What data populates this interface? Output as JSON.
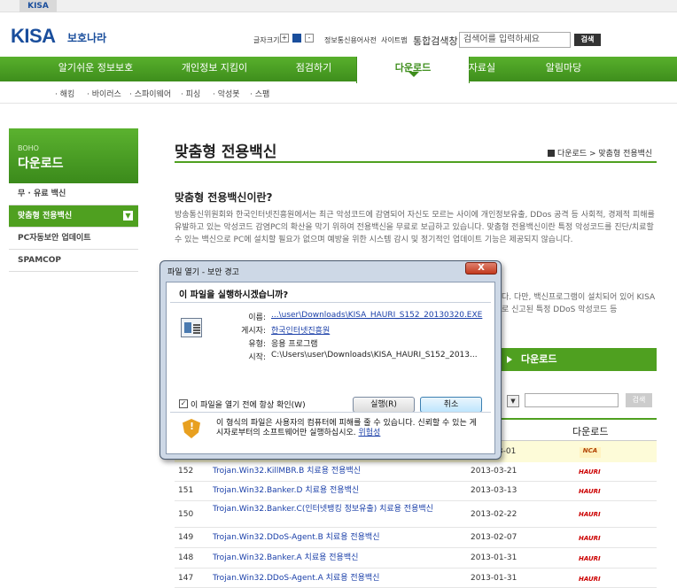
{
  "top": {
    "kisa_tab": "KISA"
  },
  "logo": {
    "main": "KISA",
    "sub": "보호나라"
  },
  "utility": {
    "font_size_label": "글자크기",
    "plus": "+",
    "reset": "■",
    "minus": "-",
    "links": [
      "정보통신용어사전",
      "사이트맵"
    ],
    "search_label": "통합검색창",
    "search_placeholder": "검색어를 입력하세요",
    "search_button": "검색"
  },
  "gnb": {
    "items": [
      "알기쉬운 정보보호",
      "개인정보 지킴이",
      "점검하기",
      "다운로드",
      "자료실",
      "알림마당"
    ]
  },
  "subnav": {
    "items": [
      "· 해킹",
      "· 바이러스",
      "· 스파이웨어",
      "· 피싱",
      "· 악성봇",
      "· 스팸"
    ]
  },
  "lnb": {
    "head_en": "BOHO",
    "head_ko": "다운로드",
    "items": [
      "무 · 유료 백신",
      "맞춤형 전용백신",
      "PC자동보안 업데이트",
      "SPAMCOP"
    ]
  },
  "content": {
    "page_title": "맞춤형 전용백신",
    "breadcrumb": "다운로드 > 맞춤형 전용백신",
    "section_title": "맞춤형 전용백신이란?",
    "paragraph": "방송통신위원회와 한국인터넷진흥원에서는 최근 악성코드에 감염되어 자신도 모르는 사이에 개인정보유출, DDos 공격 등 사회적, 경제적 피해를 유발하고 있는 악성코드 감염PC의 확산을 막기 위하여 전용백신을 무료로 보급하고 있습니다. 맞춤형 전용백신이란 특정 악성코드를 진단/치료할 수 있는 백신으로 PC에 설치할 필요가 없으며 예방을 위한 시스템 감시 및 정기적인 업데이트 기능은 제공되지 않습니다.",
    "paragraph2": "다. 다만, 백신프로그램이 설치되어 있어 KISA로 신고된 특정 DDoS 악성코드 등",
    "download_tab": "다운로드",
    "table_search_button": "검색",
    "table_header_download": "다운로드"
  },
  "table": {
    "highlight_date": "2013-03-01",
    "rows": [
      {
        "num": "152",
        "title": "Trojan.Win32.KillMBR.B 치료용 전용백신",
        "date": "2013-03-21",
        "vendor": "HAURI"
      },
      {
        "num": "151",
        "title": "Trojan.Win32.Banker.D 치료용 전용백신",
        "date": "2013-03-13",
        "vendor": "HAURI"
      },
      {
        "num": "150",
        "title": "Trojan.Win32.Banker.C(인터넷뱅킹 정보유출) 치료용 전용백신",
        "date": "2013-02-22",
        "vendor": "HAURI"
      },
      {
        "num": "149",
        "title": "Trojan.Win32.DDoS-Agent.B 치료용 전용백신",
        "date": "2013-02-07",
        "vendor": "HAURI"
      },
      {
        "num": "148",
        "title": "Trojan.Win32.Banker.A 치료용 전용백신",
        "date": "2013-01-31",
        "vendor": "HAURI"
      },
      {
        "num": "147",
        "title": "Trojan.Win32.DDoS-Agent.A 치료용 전용백신",
        "date": "2013-01-31",
        "vendor": "HAURI"
      }
    ],
    "ncab_label": "NCA"
  },
  "dialog": {
    "title": "파일 열기 - 보안 경고",
    "close": "X",
    "question": "이 파일을 실행하시겠습니까?",
    "name_label": "이름:",
    "name_value": "...\\user\\Downloads\\KISA_HAURI_S152_20130320.EXE",
    "publisher_label": "게시자:",
    "publisher_value": "한국인터넷진흥원",
    "type_label": "유형:",
    "type_value": "응용 프로그램",
    "from_label": "시작:",
    "from_value": "C:\\Users\\user\\Downloads\\KISA_HAURI_S152_2013...",
    "run_button": "실행(R)",
    "cancel_button": "취소",
    "checkbox_label": "이 파일을 열기 전에 항상 확인(W)",
    "checkbox_mark": "✓",
    "warning_text": "이 형식의 파일은 사용자의 컴퓨터에 피해를 줄 수 있습니다. 신뢰할 수 있는 게시자로부터의 소프트웨어만 실행하십시오.",
    "risk_link": "위험성"
  }
}
